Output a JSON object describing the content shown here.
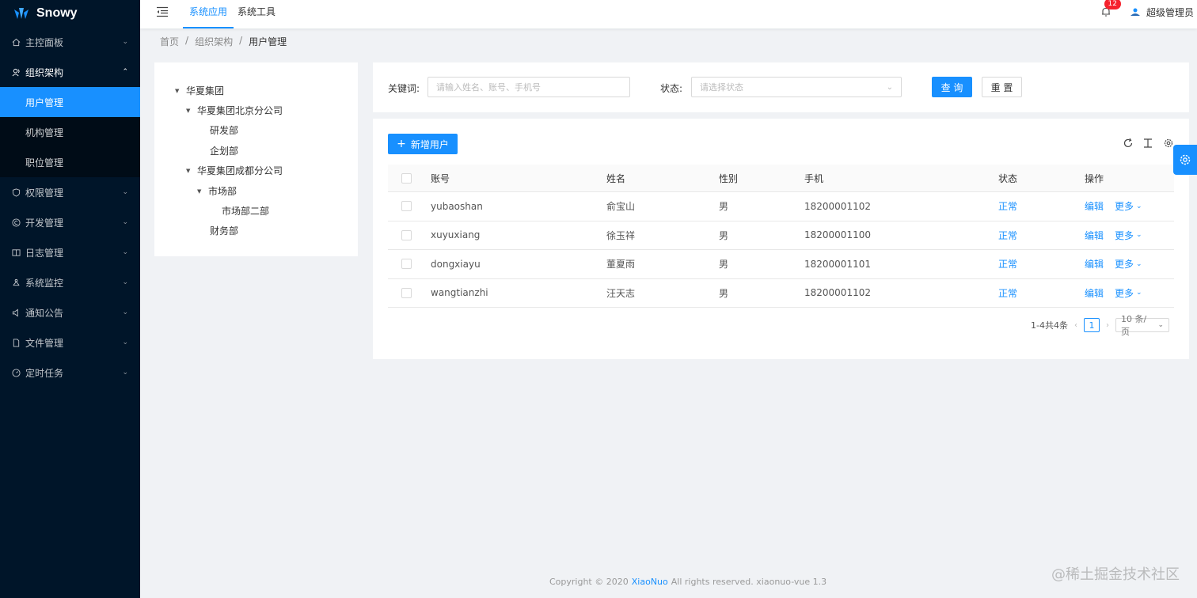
{
  "brand": {
    "name": "Snowy"
  },
  "sidebar": {
    "items": [
      {
        "label": "主控面板",
        "icon": "home-icon",
        "expanded": false
      },
      {
        "label": "组织架构",
        "icon": "team-icon",
        "expanded": true,
        "children": [
          {
            "label": "用户管理",
            "active": true
          },
          {
            "label": "机构管理"
          },
          {
            "label": "职位管理"
          }
        ]
      },
      {
        "label": "权限管理",
        "icon": "shield-icon",
        "expanded": false
      },
      {
        "label": "开发管理",
        "icon": "copyright-icon",
        "expanded": false
      },
      {
        "label": "日志管理",
        "icon": "read-icon",
        "expanded": false
      },
      {
        "label": "系统监控",
        "icon": "cluster-icon",
        "expanded": false
      },
      {
        "label": "通知公告",
        "icon": "sound-icon",
        "expanded": false
      },
      {
        "label": "文件管理",
        "icon": "file-icon",
        "expanded": false
      },
      {
        "label": "定时任务",
        "icon": "dashboard-icon",
        "expanded": false
      }
    ]
  },
  "header": {
    "tabs": [
      {
        "label": "系统应用",
        "active": true
      },
      {
        "label": "系统工具"
      }
    ],
    "notification_count": "12",
    "username": "超级管理员"
  },
  "breadcrumb": {
    "items": [
      "首页",
      "组织架构",
      "用户管理"
    ]
  },
  "tree": {
    "nodes": [
      {
        "label": "华夏集团",
        "level": 0,
        "expandable": true
      },
      {
        "label": "华夏集团北京分公司",
        "level": 1,
        "expandable": true
      },
      {
        "label": "研发部",
        "level": 2,
        "expandable": false
      },
      {
        "label": "企划部",
        "level": 2,
        "expandable": false
      },
      {
        "label": "华夏集团成都分公司",
        "level": 1,
        "expandable": true
      },
      {
        "label": "市场部",
        "level": 2,
        "expandable": true
      },
      {
        "label": "市场部二部",
        "level": 3,
        "expandable": false
      },
      {
        "label": "财务部",
        "level": 2,
        "expandable": false
      }
    ]
  },
  "search": {
    "keyword_label": "关键词:",
    "keyword_placeholder": "请输入姓名、账号、手机号",
    "status_label": "状态:",
    "status_placeholder": "请选择状态",
    "query_button": "查 询",
    "reset_button": "重 置"
  },
  "table": {
    "add_button": "新增用户",
    "columns": [
      "账号",
      "姓名",
      "性别",
      "手机",
      "状态",
      "操作"
    ],
    "rows": [
      {
        "account": "yubaoshan",
        "name": "俞宝山",
        "gender": "男",
        "phone": "18200001102",
        "status": "正常",
        "edit": "编辑",
        "more": "更多"
      },
      {
        "account": "xuyuxiang",
        "name": "徐玉祥",
        "gender": "男",
        "phone": "18200001100",
        "status": "正常",
        "edit": "编辑",
        "more": "更多"
      },
      {
        "account": "dongxiayu",
        "name": "董夏雨",
        "gender": "男",
        "phone": "18200001101",
        "status": "正常",
        "edit": "编辑",
        "more": "更多"
      },
      {
        "account": "wangtianzhi",
        "name": "汪天志",
        "gender": "男",
        "phone": "18200001102",
        "status": "正常",
        "edit": "编辑",
        "more": "更多"
      }
    ],
    "pagination": {
      "total_text": "1-4共4条",
      "current_page": "1",
      "page_size": "10 条/页"
    }
  },
  "footer": {
    "prefix": "Copyright © 2020",
    "link": "XiaoNuo",
    "suffix": "All rights reserved. xiaonuo-vue 1.3"
  },
  "watermark": "@稀土掘金技术社区",
  "colors": {
    "sidebar_bg": "#001529",
    "submenu_bg": "#000c17",
    "primary": "#1890ff",
    "page_bg": "#f0f2f5"
  }
}
